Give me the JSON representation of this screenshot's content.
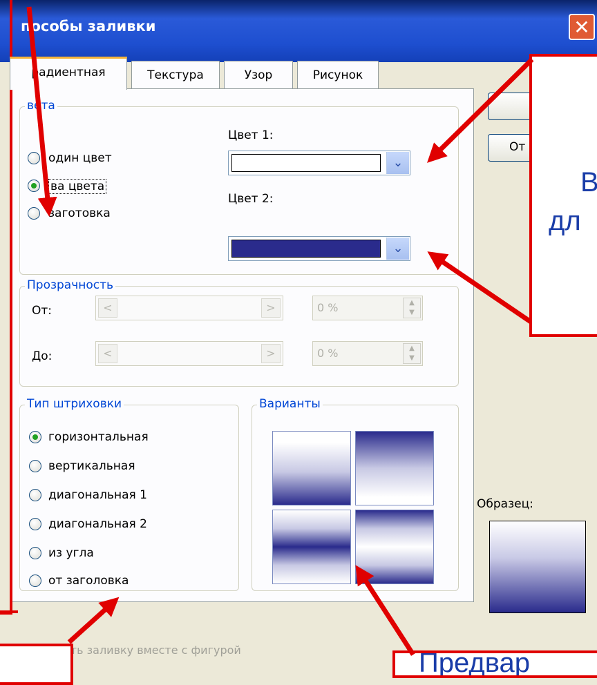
{
  "title_bar": {
    "title": "пособы заливки",
    "close_symbol": "✕"
  },
  "tabs": [
    {
      "label": "радиентная",
      "active": true
    },
    {
      "label": "Текстура",
      "active": false
    },
    {
      "label": "Узор",
      "active": false
    },
    {
      "label": "Рисунок",
      "active": false
    }
  ],
  "colors_group": {
    "label": "вета",
    "radios": [
      {
        "label": "один цвет",
        "checked": false
      },
      {
        "label": "ва цвета",
        "checked": true
      },
      {
        "label": "заготовка",
        "checked": false
      }
    ],
    "color1_label": "Цвет 1:",
    "color1_value": "#ffffff",
    "color2_label": "Цвет 2:",
    "color2_value": "#2a2b8c",
    "dropdown_symbol": "⌄"
  },
  "transparency_group": {
    "label": "Прозрачность",
    "from_label": "От:",
    "to_label": "До:",
    "from_value": "0 %",
    "to_value": "0 %",
    "left_symbol": "<",
    "right_symbol": ">"
  },
  "shading_group": {
    "label": "Тип штриховки",
    "radios": [
      {
        "label": "горизонтальная",
        "checked": true
      },
      {
        "label": "вертикальная",
        "checked": false
      },
      {
        "label": "диагональная 1",
        "checked": false
      },
      {
        "label": "диагональная 2",
        "checked": false
      },
      {
        "label": "из угла",
        "checked": false
      },
      {
        "label": "от заголовка",
        "checked": false
      }
    ]
  },
  "variants_group": {
    "label": "Варианты"
  },
  "buttons": {
    "cancel_partial": "От"
  },
  "sample": {
    "label": "Образец:"
  },
  "bottom_checkbox": {
    "label": "ать заливку вместе с фигурой"
  },
  "callouts": {
    "right_letter": "В",
    "right_fragment": "дл",
    "bottom_fragment": "Предвар"
  }
}
